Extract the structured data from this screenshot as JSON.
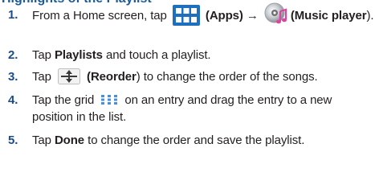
{
  "header": {
    "title_clipped": "Highlights of the Playlist"
  },
  "steps": [
    {
      "number": "1.",
      "text_a": "From a Home screen, tap",
      "apps_label": "(Apps)",
      "arrow": " → ",
      "music_label": "(Music player",
      "text_b": ")."
    },
    {
      "number": "2.",
      "text_a": "Tap ",
      "bold_a": "Playlists",
      "text_b": " and touch a playlist."
    },
    {
      "number": "3.",
      "text_a": "Tap",
      "bold_a": "(Reorder",
      "text_b": ") to change the order of the songs."
    },
    {
      "number": "4.",
      "text_a": "Tap the grid",
      "text_b": "on an entry and drag the entry to a new position in the list."
    },
    {
      "number": "5.",
      "text_a": "Tap ",
      "bold_a": "Done",
      "text_b": " to change the order and save the playlist."
    }
  ],
  "icons": {
    "apps": "apps-grid-icon",
    "music": "music-player-icon",
    "reorder": "reorder-icon",
    "grid": "drag-grid-icon"
  },
  "colors": {
    "number": "#1a4c8b",
    "apps_icon": "#1f6fbf",
    "text": "#231f20"
  }
}
